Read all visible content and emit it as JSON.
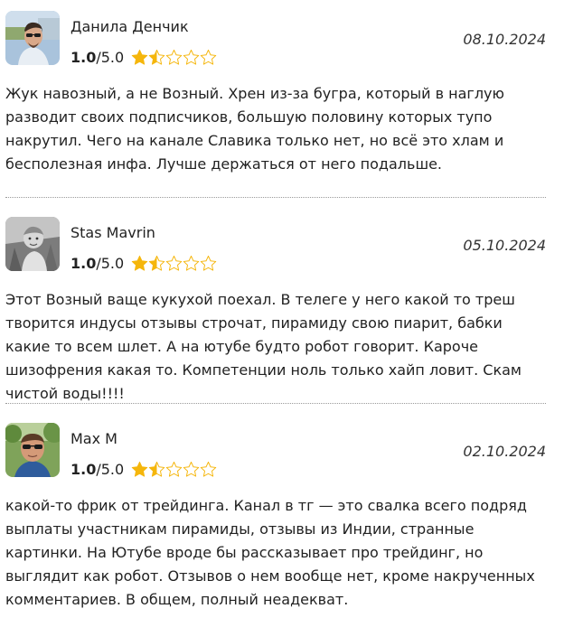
{
  "colors": {
    "star_filled": "#f5b60c",
    "star_outline": "#f5b60c",
    "divider": "#9a9a9a"
  },
  "reviews": [
    {
      "author": "Данила Денчик",
      "score": "1.0",
      "scale": "/5.0",
      "stars_filled": 1.5,
      "date": "08.10.2024",
      "avatar_icon": "user-avatar-sunglasses",
      "text": "Жук навозный, а не Возный. Хрен из-за бугра, который в наглую разводит своих подписчиков, большую половину которых тупо накрутил. Чего на канале Славика только нет, но всё это хлам и бесполезная инфа. Лучше держаться от него подальше."
    },
    {
      "author": "Stas Mavrin",
      "score": "1.0",
      "scale": "/5.0",
      "stars_filled": 1.5,
      "date": "05.10.2024",
      "avatar_icon": "user-avatar-child-photo",
      "text": "Этот Возный ваще кукухой поехал. В телеге у него какой то треш творится индусы отзывы строчат, пирамиду свою пиарит, бабки какие то всем шлет. А на ютубе будто робот говорит. Кароче шизофрения какая то. Компетенции ноль только хайп ловит. Скам чистой воды!!!!"
    },
    {
      "author": "Max M",
      "score": "1.0",
      "scale": "/5.0",
      "stars_filled": 1.5,
      "date": "02.10.2024",
      "avatar_icon": "user-avatar-sunglasses-outdoor",
      "text": "какой-то фрик от трейдинга. Канал в тг — это свалка всего подряд выплаты участникам пирамиды, отзывы из Индии, странные картинки. На Ютубе вроде бы рассказывает про трейдинг, но выглядит как робот. Отзывов о нем вообще нет, кроме накрученных комментариев. В общем, полный неадекват."
    }
  ]
}
